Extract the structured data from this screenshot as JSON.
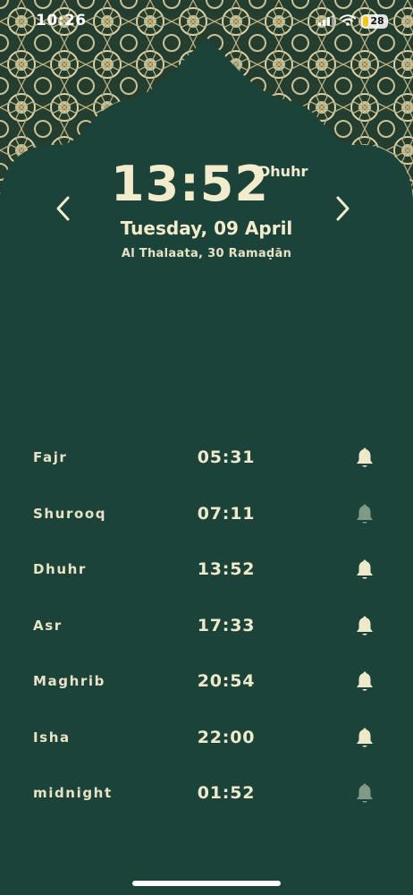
{
  "status_bar": {
    "time": "10:26",
    "battery": "28"
  },
  "header": {
    "current_time": "13:52",
    "current_prayer": "Dhuhr",
    "gregorian_date": "Tuesday, 09 April",
    "hijri_date": "Al Thalaata, 30 Ramaḍān"
  },
  "colors": {
    "background": "#1b4339",
    "text": "#ece6c8",
    "bell_on": "#efe9cb",
    "bell_off": "#7f9a86"
  },
  "prayers": [
    {
      "name": "Fajr",
      "time": "05:31",
      "alert": true
    },
    {
      "name": "Shurooq",
      "time": "07:11",
      "alert": false
    },
    {
      "name": "Dhuhr",
      "time": "13:52",
      "alert": true
    },
    {
      "name": "Asr",
      "time": "17:33",
      "alert": true
    },
    {
      "name": "Maghrib",
      "time": "20:54",
      "alert": true
    },
    {
      "name": "Isha",
      "time": "22:00",
      "alert": true
    },
    {
      "name": "midnight",
      "time": "01:52",
      "alert": false
    }
  ]
}
